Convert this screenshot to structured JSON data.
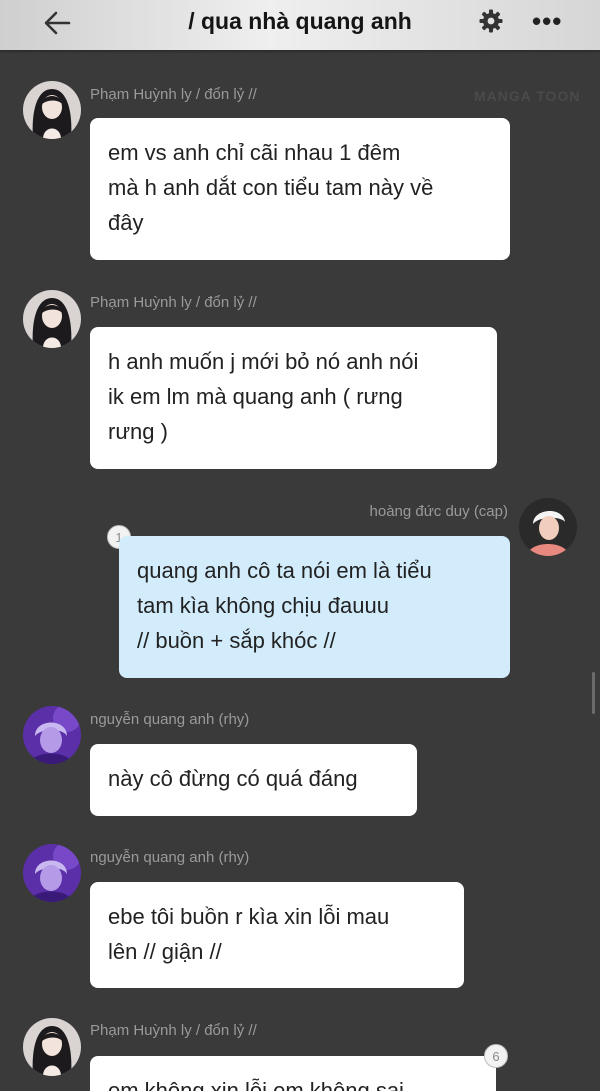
{
  "header": {
    "title": "/ qua nhà quang anh",
    "back_icon": "arrow-left-icon",
    "settings_icon": "gear-icon",
    "more_icon": "more-horizontal-icon",
    "more_glyph": "•••"
  },
  "watermark": "MANGA TOON",
  "messages": [
    {
      "sender": "Phạm Huỳnh ly / đổn lỷ //",
      "lines": [
        "em vs anh chỉ cãi nhau 1 đêm",
        "mà h anh dắt con tiểu tam này về",
        "đây"
      ]
    },
    {
      "sender": "Phạm Huỳnh ly / đổn lỷ //",
      "lines": [
        "h anh muốn j mới bỏ nó anh nói",
        "ik em lm mà quang anh ( rưng",
        "rưng )"
      ]
    },
    {
      "sender": "hoàng đức duy (cap)",
      "badge": "1",
      "lines": [
        "quang anh cô ta nói em là tiểu",
        "tam kìa không chịu đauuu",
        "// buồn + sắp khóc //"
      ]
    },
    {
      "sender": "nguyễn quang anh (rhy)",
      "lines": [
        "này cô đừng có quá đáng"
      ]
    },
    {
      "sender": "nguyễn quang anh (rhy)",
      "lines": [
        "ebe tôi buồn r kìa xin lỗi mau",
        "lên // giận //"
      ]
    },
    {
      "sender": "Phạm Huỳnh ly / đổn lỷ //",
      "badge": "6",
      "lines": [
        "em không xin lỗi em không sai"
      ]
    }
  ]
}
